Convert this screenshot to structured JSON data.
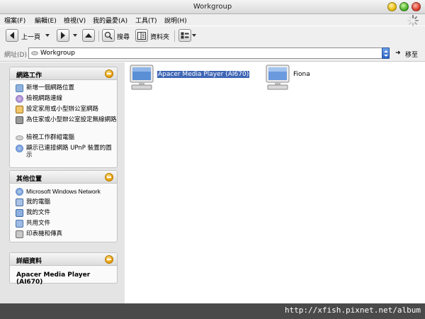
{
  "window": {
    "title": "Workgroup"
  },
  "menu": [
    {
      "label": "檔案(F)"
    },
    {
      "label": "編輯(E)"
    },
    {
      "label": "檢視(V)"
    },
    {
      "label": "我的最愛(A)"
    },
    {
      "label": "工具(T)"
    },
    {
      "label": "說明(H)"
    }
  ],
  "toolbar": {
    "back_label": "上一頁",
    "search_label": "搜尋",
    "folders_label": "資料夾"
  },
  "address": {
    "label": "網址(D)",
    "value": "Workgroup",
    "go_label": "移至"
  },
  "network_tasks": {
    "title": "網路工作",
    "items": [
      {
        "label": "新增一個網路位置",
        "icon": "add-network-place-icon"
      },
      {
        "label": "檢視網路連線",
        "icon": "network-connections-icon"
      },
      {
        "label": "設定家用或小型辦公室網路",
        "icon": "home-network-setup-icon"
      },
      {
        "label": "為住家或小型辦公室設定無線網路",
        "icon": "wireless-setup-icon"
      },
      {
        "label": "檢視工作群組電腦",
        "icon": "workgroup-computers-icon"
      },
      {
        "label": "顯示已連接網路 UPnP 裝置的圖示",
        "icon": "upnp-devices-icon"
      }
    ]
  },
  "other_places": {
    "title": "其他位置",
    "items": [
      {
        "label": "Microsoft Windows Network",
        "icon": "windows-network-icon"
      },
      {
        "label": "我的電腦",
        "icon": "my-computer-icon"
      },
      {
        "label": "我的文件",
        "icon": "my-documents-icon"
      },
      {
        "label": "共用文件",
        "icon": "shared-documents-icon"
      },
      {
        "label": "印表機和傳真",
        "icon": "printers-faxes-icon"
      }
    ]
  },
  "details": {
    "title": "詳細資料",
    "selected_name": "Apacer Media Player (AI670)"
  },
  "computers": [
    {
      "name": "Apacer Media Player (AI670)",
      "selected": true
    },
    {
      "name": "Fiona",
      "selected": false
    }
  ],
  "watermark": "http://xfish.pixnet.net/album",
  "colors": {
    "selection": "#3f66b5",
    "sidebar_bg": "#e4e4e4",
    "toggle": "#e89a00"
  }
}
